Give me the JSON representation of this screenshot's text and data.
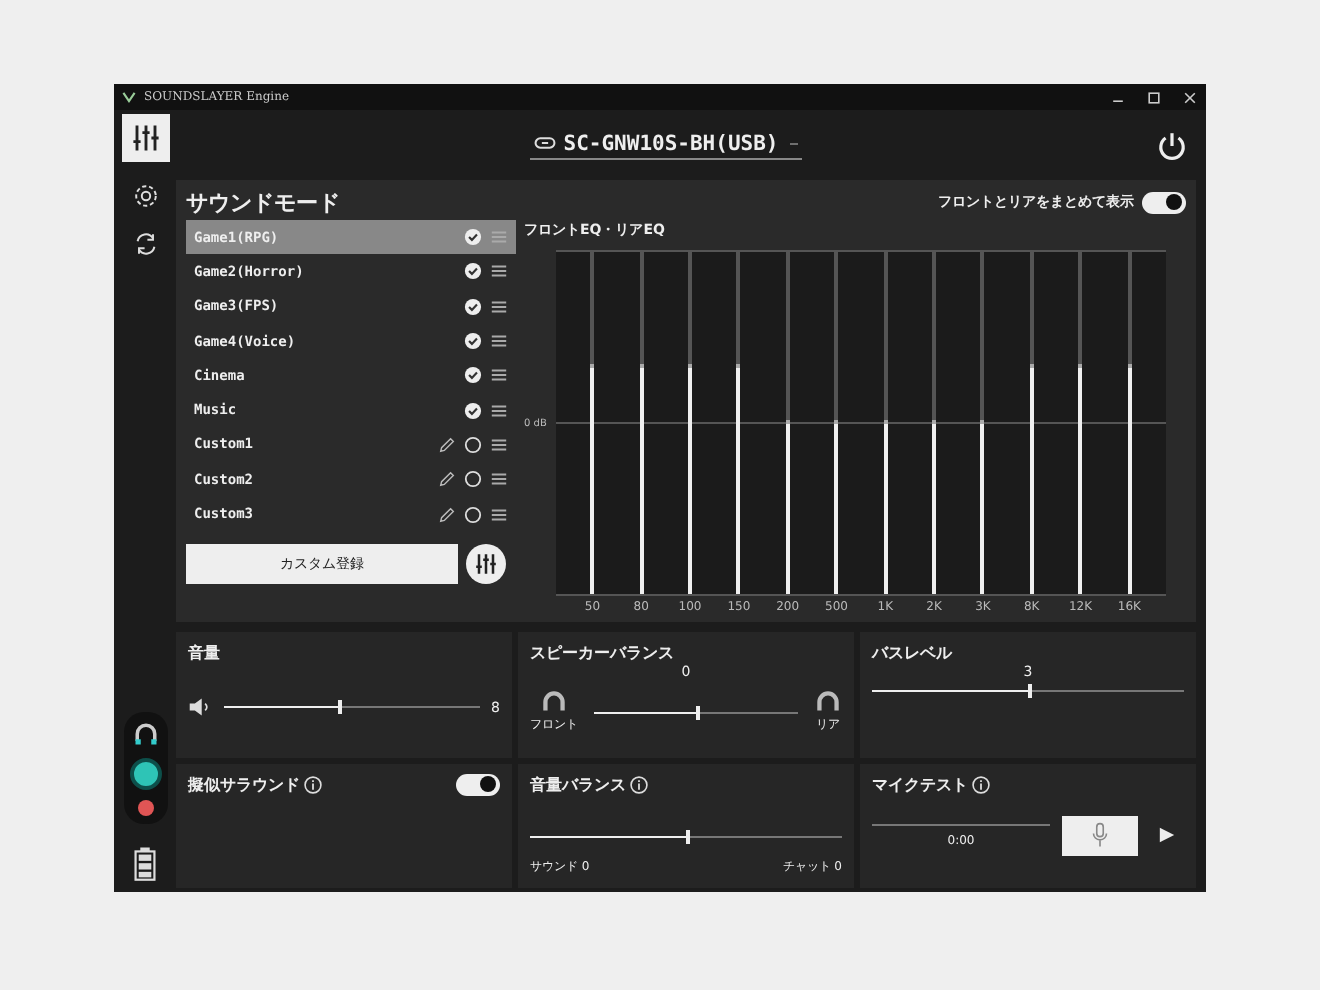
{
  "window": {
    "title": "SOUNDSLAYER Engine"
  },
  "device": {
    "name": "SC-GNW10S-BH(USB)"
  },
  "sound_mode": {
    "title": "サウンドモード",
    "combine_label": "フロントとリアをまとめて表示",
    "combine_on": true,
    "modes": [
      {
        "label": "Game1(RPG)",
        "kind": "preset",
        "selected": true
      },
      {
        "label": "Game2(Horror)",
        "kind": "preset",
        "selected": false
      },
      {
        "label": "Game3(FPS)",
        "kind": "preset",
        "selected": false
      },
      {
        "label": "Game4(Voice)",
        "kind": "preset",
        "selected": false
      },
      {
        "label": "Cinema",
        "kind": "preset",
        "selected": false
      },
      {
        "label": "Music",
        "kind": "preset",
        "selected": false
      },
      {
        "label": "Custom1",
        "kind": "custom",
        "selected": false
      },
      {
        "label": "Custom2",
        "kind": "custom",
        "selected": false
      },
      {
        "label": "Custom3",
        "kind": "custom",
        "selected": false
      }
    ],
    "register_button": "カスタム登録",
    "eq": {
      "title": "フロントEQ・リアEQ",
      "zero_label": "0 dB",
      "bands": [
        {
          "label": "50",
          "level": 0.66
        },
        {
          "label": "80",
          "level": 0.66
        },
        {
          "label": "100",
          "level": 0.66
        },
        {
          "label": "150",
          "level": 0.66
        },
        {
          "label": "200",
          "level": 0.5
        },
        {
          "label": "500",
          "level": 0.5
        },
        {
          "label": "1K",
          "level": 0.5
        },
        {
          "label": "2K",
          "level": 0.5
        },
        {
          "label": "3K",
          "level": 0.5
        },
        {
          "label": "8K",
          "level": 0.66
        },
        {
          "label": "12K",
          "level": 0.66
        },
        {
          "label": "16K",
          "level": 0.66
        }
      ]
    }
  },
  "volume": {
    "title": "音量",
    "level": 0.45,
    "reading": "8"
  },
  "speaker_balance": {
    "title": "スピーカーバランス",
    "level": 0.5,
    "reading": "0",
    "left_label": "フロント",
    "right_label": "リア"
  },
  "bass_level": {
    "title": "バスレベル",
    "level": 0.5,
    "reading": "3"
  },
  "surround": {
    "title": "擬似サラウンド",
    "on": true
  },
  "volume_balance": {
    "title": "音量バランス",
    "level": 0.5,
    "left_label": "サウンド 0",
    "right_label": "チャット 0"
  },
  "mic_test": {
    "title": "マイクテスト",
    "time": "0:00"
  }
}
